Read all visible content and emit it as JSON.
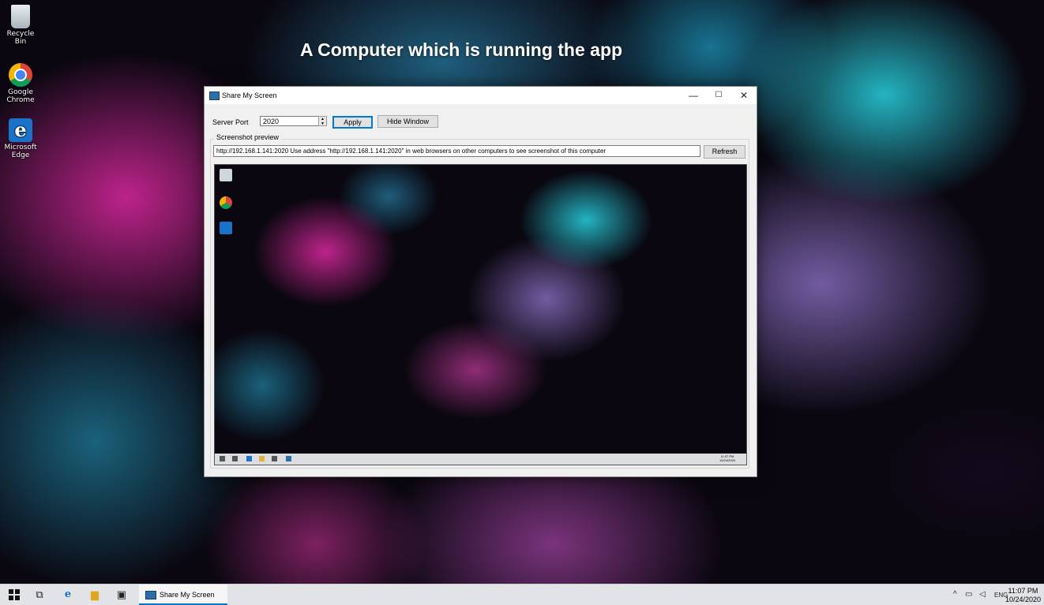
{
  "overlay_title": "A Computer which is running the app",
  "desktop_icons": [
    {
      "label": "Recycle Bin",
      "icon": "recycle-bin-icon"
    },
    {
      "label": "Google Chrome",
      "icon": "chrome-icon"
    },
    {
      "label": "Microsoft Edge",
      "icon": "edge-icon"
    }
  ],
  "window": {
    "title": "Share My Screen",
    "minimize": "—",
    "maximize": "☐",
    "close": "✕",
    "server_port_label": "Server Port",
    "server_port_value": "2020",
    "apply_label": "Apply",
    "hide_label": "Hide Window",
    "preview_group_label": "Screenshot preview",
    "url_text": "http://192.168.1.141:2020   Use address \"http://192.168.1.141:2020\" in web browsers on other computers to see screenshot of this computer",
    "refresh_label": "Refresh"
  },
  "taskbar": {
    "app_label": "Share My Screen",
    "language": "ENG",
    "time": "11:07 PM",
    "date": "10/24/2020"
  },
  "preview_taskbar": {
    "time": "11:07 PM",
    "date": "10/24/2020"
  }
}
